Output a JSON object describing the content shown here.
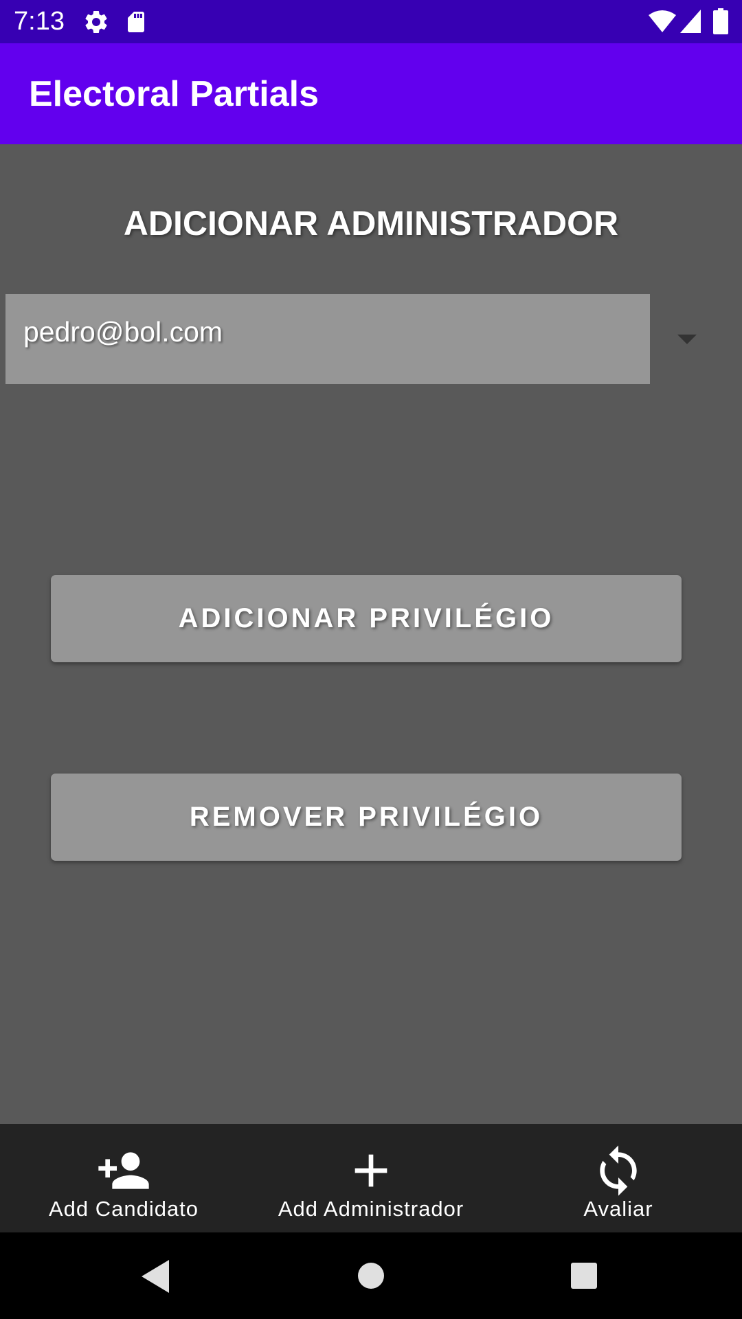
{
  "status_bar": {
    "time": "7:13",
    "left_icons": [
      "settings-gear-icon",
      "sd-card-icon"
    ],
    "right_icons": [
      "wifi-icon",
      "cell-signal-icon",
      "battery-icon"
    ],
    "background": "#3700b3"
  },
  "app_bar": {
    "title": "Electoral Partials",
    "background": "#6200ee"
  },
  "main": {
    "section_title": "ADICIONAR ADMINISTRADOR",
    "spinner": {
      "selected_value": "pedro@bol.com",
      "icon": "dropdown-arrow-icon"
    },
    "add_button_label": "ADICIONAR PRIVILÉGIO",
    "remove_button_label": "REMOVER PRIVILÉGIO",
    "background": "#595959"
  },
  "bottom_nav": {
    "items": [
      {
        "label": "Add Candidato",
        "icon": "add-person-icon"
      },
      {
        "label": "Add Administrador",
        "icon": "plus-icon"
      },
      {
        "label": "Avaliar",
        "icon": "sync-icon"
      }
    ],
    "background": "#232323"
  },
  "system_nav": {
    "icons": [
      "back-icon",
      "home-icon",
      "recents-icon"
    ]
  }
}
